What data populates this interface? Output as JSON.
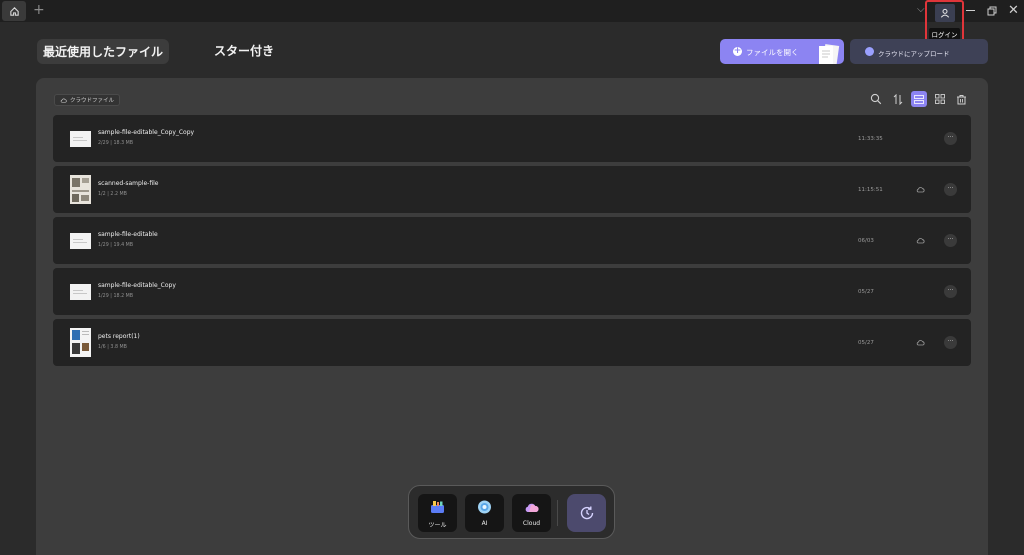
{
  "titlebar": {
    "new_tab": "+",
    "login_tooltip": "ログイン",
    "icons": {
      "home": "home-icon",
      "user": "user-icon",
      "minimize": "minimize-icon",
      "restore": "restore-icon",
      "close": "close-icon",
      "dropdown": "chevron-down-icon"
    }
  },
  "tabs": {
    "recent": "最近使用したファイル",
    "starred": "スター付き"
  },
  "actions": {
    "open_file": "ファイルを開く",
    "upload_cloud": "クラウドにアップロード"
  },
  "panel": {
    "cloud_files_label": "クラウドファイル",
    "toolbar_icons": [
      "search-icon",
      "sort-icon",
      "list-view-icon",
      "grid-view-icon",
      "trash-icon"
    ]
  },
  "files": [
    {
      "name": "sample-file-editable_Copy_Copy",
      "meta": "2/29 | 18.3 MB",
      "date": "11:33:35",
      "cloud": false,
      "thumb": "doc"
    },
    {
      "name": "scanned-sample-file",
      "meta": "1/2 | 2.2 MB",
      "date": "11:15:51",
      "cloud": true,
      "thumb": "scan"
    },
    {
      "name": "sample-file-editable",
      "meta": "1/29 | 19.4 MB",
      "date": "06/03",
      "cloud": true,
      "thumb": "doc"
    },
    {
      "name": "sample-file-editable_Copy",
      "meta": "1/29 | 18.2 MB",
      "date": "05/27",
      "cloud": false,
      "thumb": "doc"
    },
    {
      "name": "pets report(1)",
      "meta": "1/6 | 3.8 MB",
      "date": "05/27",
      "cloud": true,
      "thumb": "report"
    }
  ],
  "dock": {
    "tools": "ツール",
    "ai": "AI",
    "cloud": "Cloud"
  },
  "colors": {
    "accent": "#8c84f2",
    "login_highlight": "#e0353a"
  }
}
